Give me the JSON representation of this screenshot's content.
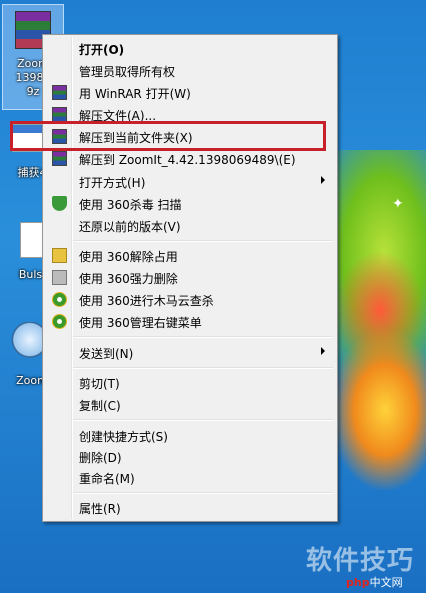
{
  "desktop": {
    "icons": [
      {
        "name": "zoomit-archive",
        "label_line1": "Zoom",
        "label_line2": "13980",
        "label_line3": "9z"
      },
      {
        "name": "screenshot-file",
        "label": "捕获4"
      },
      {
        "name": "document-file",
        "label": "Bulsi"
      },
      {
        "name": "zoomit-app",
        "label": "Zoom"
      }
    ]
  },
  "menu": {
    "items": [
      {
        "label": "打开(O)",
        "bold": true
      },
      {
        "label": "管理员取得所有权"
      },
      {
        "label": "用 WinRAR 打开(W)"
      },
      {
        "label": "解压文件(A)..."
      },
      {
        "label": "解压到当前文件夹(X)"
      },
      {
        "label": "解压到 ZoomIt_4.42.1398069489\\(E)"
      },
      {
        "label": "打开方式(H)"
      },
      {
        "label": "使用 360杀毒 扫描"
      },
      {
        "label": "还原以前的版本(V)"
      },
      {
        "label": "使用 360解除占用"
      },
      {
        "label": "使用 360强力删除"
      },
      {
        "label": "使用 360进行木马云查杀"
      },
      {
        "label": "使用 360管理右键菜单"
      },
      {
        "label": "发送到(N)"
      },
      {
        "label": "剪切(T)"
      },
      {
        "label": "复制(C)"
      },
      {
        "label": "创建快捷方式(S)"
      },
      {
        "label": "删除(D)"
      },
      {
        "label": "重命名(M)"
      },
      {
        "label": "属性(R)"
      }
    ]
  },
  "watermark": {
    "text": "软件技巧",
    "site_prefix": "php",
    "site_suffix": "中文网"
  },
  "colors": {
    "highlight_box": "#c8202a",
    "menu_bg": "#f0f0f0"
  }
}
